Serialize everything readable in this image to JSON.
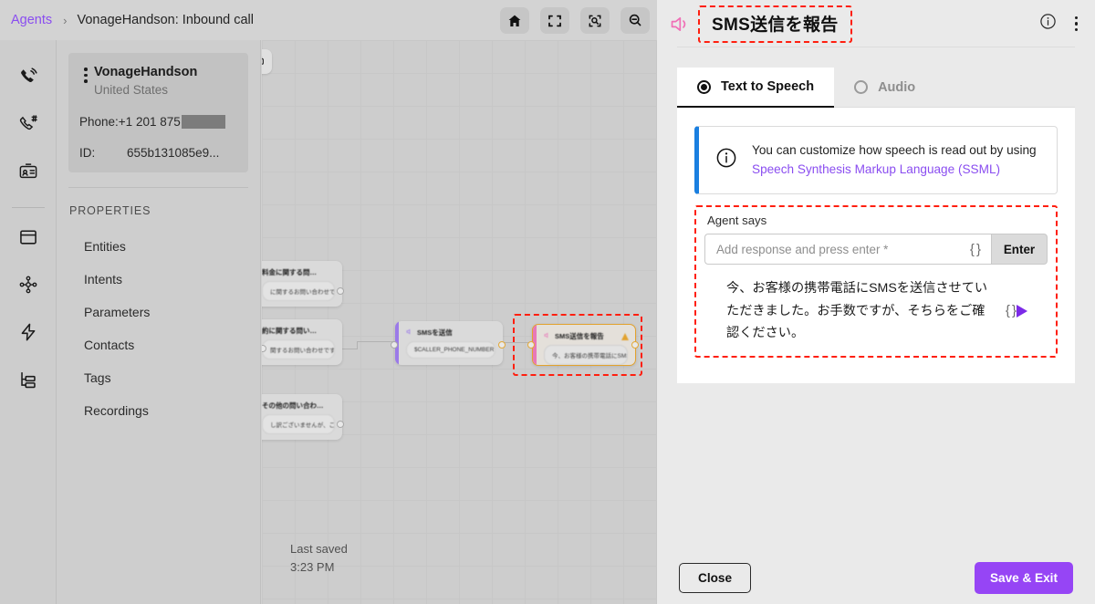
{
  "breadcrumb": {
    "root": "Agents",
    "separator": "›",
    "current": "VonageHandson: Inbound call"
  },
  "toolbar": {
    "buttons": [
      {
        "name": "home-icon",
        "label": "Home"
      },
      {
        "name": "fit-screen-icon",
        "label": "Fit to screen"
      },
      {
        "name": "zoom-to-selection-icon",
        "label": "Zoom to selection"
      },
      {
        "name": "zoom-out-icon",
        "label": "Zoom out"
      }
    ]
  },
  "rail": {
    "items": [
      {
        "icon": "phone-call-icon",
        "label": "Calls"
      },
      {
        "icon": "phone-number-icon",
        "label": "Numbers"
      },
      {
        "icon": "id-card-icon",
        "label": "Contacts"
      },
      {
        "icon": "window-icon",
        "label": "Canvas"
      },
      {
        "icon": "node-network-icon",
        "label": "Nodes"
      },
      {
        "icon": "bolt-icon",
        "label": "Events"
      },
      {
        "icon": "hierarchy-icon",
        "label": "Structure"
      }
    ]
  },
  "sidebar": {
    "agent": {
      "name": "VonageHandson",
      "country": "United States",
      "phone_label": "Phone:",
      "phone_value": "+1 201 875",
      "phone_redacted": true,
      "id_label": "ID:",
      "id_value": "655b131085e9..."
    },
    "lock_icon": "lock-icon",
    "properties_title": "PROPERTIES",
    "properties": [
      "Entities",
      "Intents",
      "Parameters",
      "Contacts",
      "Tags",
      "Recordings"
    ]
  },
  "canvas": {
    "last_saved_label": "Last saved",
    "last_saved_time": "3:23 PM",
    "nodes": [
      {
        "title": "料金に関する問…",
        "body": "に関するお問い合わせで…",
        "accent": "#b38cf0",
        "selected": false
      },
      {
        "title": "約に関する問い…",
        "body": "関するお問い合わせです…",
        "accent": "#b38cf0",
        "selected": false
      },
      {
        "title": "その他の問い合わ…",
        "body": "し訳ございませんが、こ…",
        "accent": "#b38cf0",
        "selected": false
      },
      {
        "title": "SMSを送信",
        "body": "$CALLER_PHONE_NUMBER",
        "accent": "#9b7ae8",
        "selected": false
      },
      {
        "title": "SMS送信を報告",
        "body": "今、お客様の携帯電話にSMSを…",
        "accent": "#e878b8",
        "selected": true,
        "warning": true
      }
    ]
  },
  "panel": {
    "speaker_icon": "speaker-icon",
    "title": "SMS送信を報告",
    "info_icon": "info-circle-icon",
    "menu_icon": "kebab-menu-icon",
    "tabs": [
      {
        "label": "Text to Speech",
        "selected": true
      },
      {
        "label": "Audio",
        "selected": false
      }
    ],
    "info_banner": {
      "icon": "info-circle-icon",
      "text": "You can customize how speech is read out by using",
      "link": "Speech Synthesis Markup Language (SSML)",
      "accent": "#1a7fe0"
    },
    "agent_says": {
      "label": "Agent says",
      "input_value": "",
      "input_placeholder": "Add response and press enter *",
      "braces_icon": "curly-braces-icon",
      "enter_label": "Enter",
      "responses": [
        {
          "text": "今、お客様の携帯電話にSMSを送信させていただきました。お手数ですが、そちらをご確認ください。",
          "braces_icon": "curly-braces-icon",
          "play_icon": "play-icon"
        }
      ]
    },
    "footer": {
      "close_label": "Close",
      "save_label": "Save & Exit",
      "save_color": "#9645f5"
    }
  },
  "highlight_color": "#ff1f0f"
}
